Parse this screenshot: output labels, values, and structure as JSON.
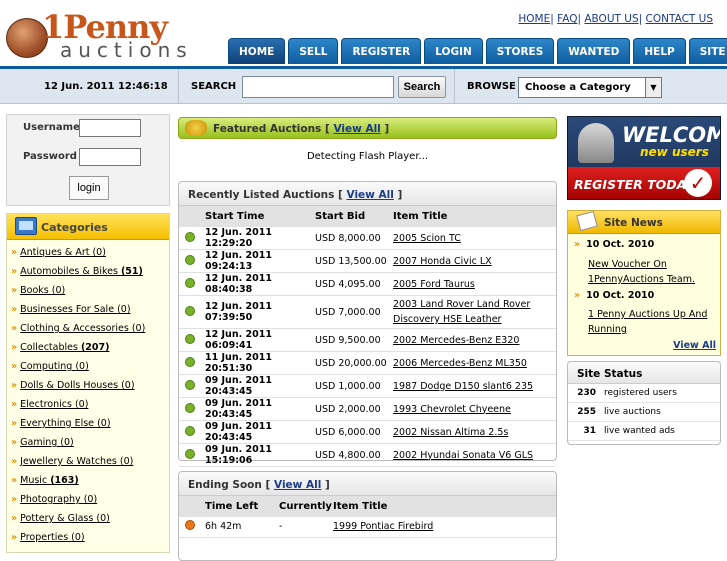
{
  "logo": {
    "line1": "1Penny",
    "line2": "auctions"
  },
  "toplinks": [
    "HOME",
    "FAQ",
    "ABOUT US",
    "CONTACT US"
  ],
  "nav": [
    "HOME",
    "SELL",
    "REGISTER",
    "LOGIN",
    "STORES",
    "WANTED ADS",
    "HELP",
    "SITE FEES"
  ],
  "bar": {
    "datetime": "12 Jun. 2011 12:46:18",
    "search_label": "SEARCH",
    "search_button": "Search",
    "browse_label": "BROWSE",
    "category_select": "Choose a Category"
  },
  "login": {
    "username_label": "Username",
    "password_label": "Password",
    "button": "login"
  },
  "categories": {
    "title": "Categories",
    "items": [
      {
        "name": "Antiques & Art",
        "count": "(0)"
      },
      {
        "name": "Automobiles & Bikes",
        "count": "(51)"
      },
      {
        "name": "Books",
        "count": "(0)"
      },
      {
        "name": "Businesses For Sale",
        "count": "(0)"
      },
      {
        "name": "Clothing & Accessories",
        "count": "(0)"
      },
      {
        "name": "Collectables",
        "count": "(207)"
      },
      {
        "name": "Computing",
        "count": "(0)"
      },
      {
        "name": "Dolls & Dolls Houses",
        "count": "(0)"
      },
      {
        "name": "Electronics",
        "count": "(0)"
      },
      {
        "name": "Everything Else",
        "count": "(0)"
      },
      {
        "name": "Gaming",
        "count": "(0)"
      },
      {
        "name": "Jewellery & Watches",
        "count": "(0)"
      },
      {
        "name": "Music",
        "count": "(163)"
      },
      {
        "name": "Photography",
        "count": "(0)"
      },
      {
        "name": "Pottery & Glass",
        "count": "(0)"
      },
      {
        "name": "Properties",
        "count": "(0)"
      }
    ]
  },
  "featured": {
    "title": "Featured Auctions",
    "view_all": "View All",
    "flash_text": "Detecting Flash Player..."
  },
  "recent": {
    "title": "Recently Listed Auctions",
    "view_all": "View All",
    "headers": [
      "Start Time",
      "Start Bid",
      "Item Title"
    ],
    "rows": [
      [
        "12 Jun. 2011 12:29:20",
        "USD 8,000.00",
        "2005 Scion TC"
      ],
      [
        "12 Jun. 2011 09:24:13",
        "USD 13,500.00",
        "2007 Honda Civic LX"
      ],
      [
        "12 Jun. 2011 08:40:38",
        "USD 4,095.00",
        "2005 Ford Taurus"
      ],
      [
        "12 Jun. 2011 07:39:50",
        "USD 7,000.00",
        "2003 Land Rover Land Rover Discovery HSE Leather"
      ],
      [
        "12 Jun. 2011 06:09:41",
        "USD 9,500.00",
        "2002 Mercedes-Benz E320"
      ],
      [
        "11 Jun. 2011 20:51:30",
        "USD 20,000.00",
        "2006 Mercedes-Benz ML350"
      ],
      [
        "09 Jun. 2011 20:43:45",
        "USD 1,000.00",
        "1987 Dodge D150 slant6 235"
      ],
      [
        "09 Jun. 2011 20:43:45",
        "USD 2,000.00",
        "1993 Chevrolet Chyeene"
      ],
      [
        "09 Jun. 2011 20:43:45",
        "USD 6,000.00",
        "2002 Nissan Altima 2.5s"
      ],
      [
        "09 Jun. 2011 15:19:06",
        "USD 4,800.00",
        "2002 Hyundai Sonata V6 GLS"
      ]
    ]
  },
  "ending": {
    "title": "Ending Soon",
    "view_all": "View All",
    "headers": [
      "Time Left",
      "Currently",
      "Item Title"
    ],
    "rows": [
      [
        "6h 42m",
        "-",
        "1999 Pontiac Firebird"
      ]
    ]
  },
  "welcome": {
    "line1": "WELCOME",
    "line2": "new users",
    "register": "REGISTER TODAY"
  },
  "news": {
    "title": "Site News",
    "items": [
      {
        "date": "10 Oct. 2010",
        "text": "New Voucher On 1PennyAuctions Team."
      },
      {
        "date": "10 Oct. 2010",
        "text": "1 Penny Auctions Up And Running"
      }
    ],
    "view_all": "View All"
  },
  "status": {
    "title": "Site Status",
    "rows": [
      {
        "num": "230",
        "label": "registered users"
      },
      {
        "num": "255",
        "label": "live auctions"
      },
      {
        "num": "31",
        "label": "live wanted ads"
      }
    ]
  }
}
